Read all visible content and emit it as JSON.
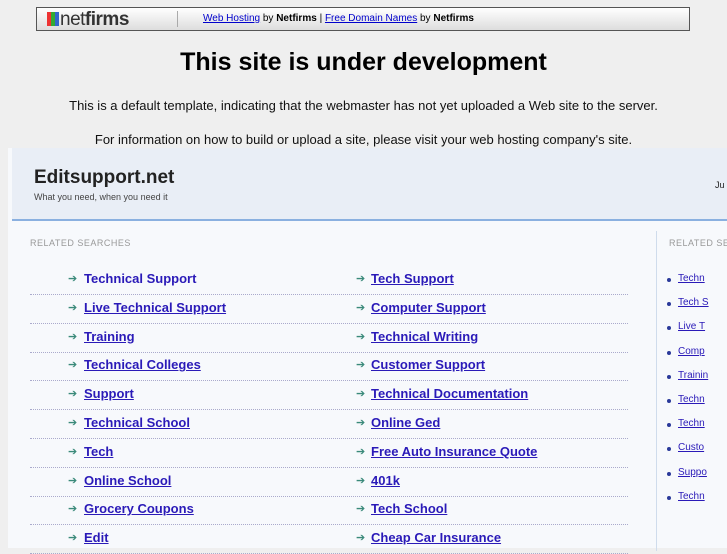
{
  "topbar": {
    "logo": "netfirms",
    "link1": "Web Hosting",
    "by1": "by",
    "brand1": "Netfirms",
    "pipe": "|",
    "link2": "Free Domain Names",
    "by2": "by",
    "brand2": "Netfirms"
  },
  "headline": "This site is under development",
  "para1": "This is a default template, indicating that the webmaster has not yet uploaded a Web site to the server.",
  "para2": "For information on how to build or upload a site, please visit your web hosting company's site.",
  "site": {
    "name": "Editsupport.net",
    "tagline": "What you need, when you need it",
    "right_text": "Ju"
  },
  "related_label": "RELATED SEARCHES",
  "related_label_right": "RELATED SE",
  "left_col": [
    "Technical Support",
    "Live Technical Support",
    "Training",
    "Technical Colleges",
    "Support",
    "Technical School",
    "Tech",
    "Online School",
    "Grocery Coupons",
    "Edit"
  ],
  "right_col": [
    "Tech Support",
    "Computer Support",
    "Technical Writing",
    "Customer Support",
    "Technical Documentation",
    "Online Ged",
    "Free Auto Insurance Quote",
    "401k",
    "Tech School",
    "Cheap Car Insurance"
  ],
  "side_col": [
    "Techn",
    "Tech S",
    "Live T",
    "Comp",
    "Trainin",
    "Techn",
    "Techn",
    "Custo",
    "Suppo",
    "Techn"
  ],
  "colors": {
    "link": "#2a1ab8",
    "accent_line": "#8ab0e0",
    "arrow": "#3a8a7a"
  }
}
